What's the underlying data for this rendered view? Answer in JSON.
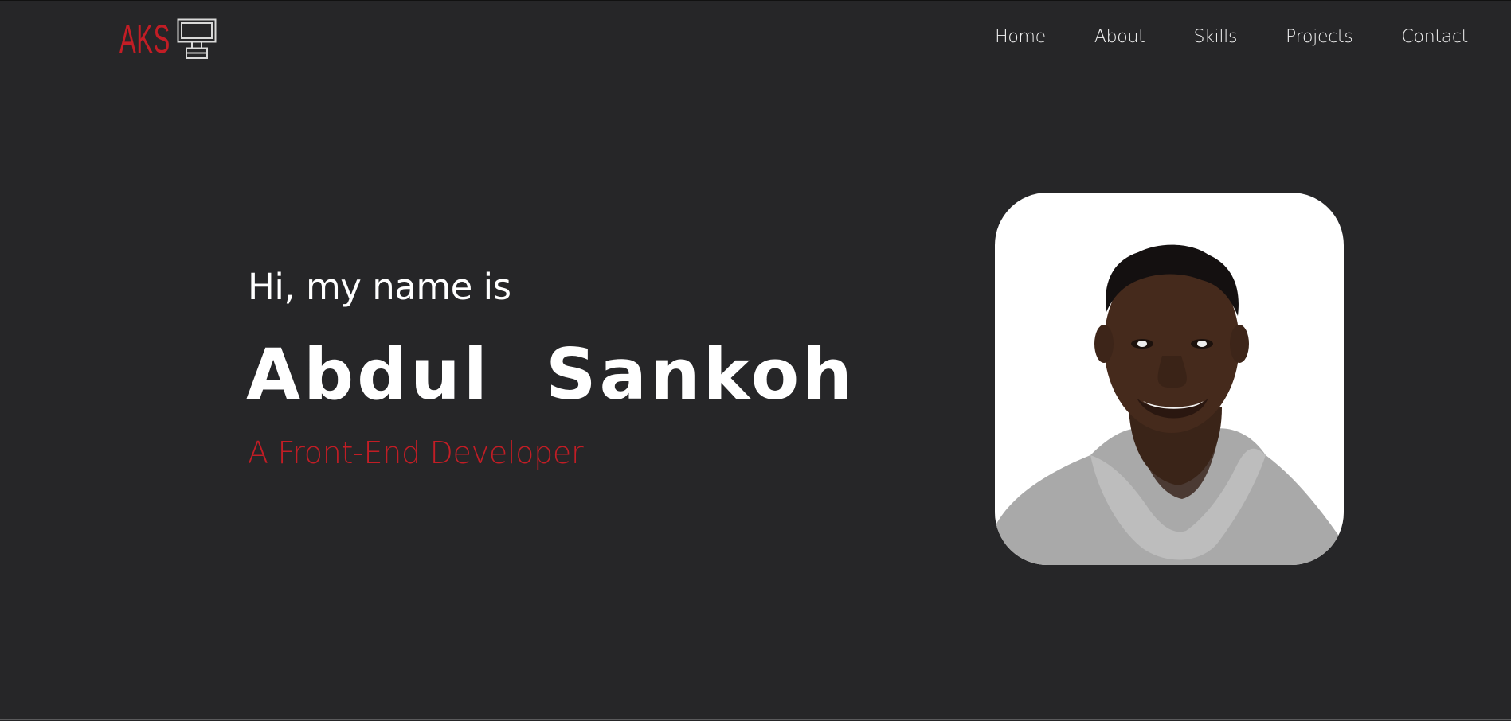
{
  "header": {
    "logo_text": "AKS",
    "logo_icon": "monitor-icon",
    "nav": [
      {
        "label": "Home"
      },
      {
        "label": "About"
      },
      {
        "label": "Skills"
      },
      {
        "label": "Projects"
      },
      {
        "label": "Contact"
      }
    ]
  },
  "hero": {
    "greeting": "Hi, my name is",
    "name": "Abdul  Sankoh",
    "role": "A Front-End Developer",
    "photo": "profile-photo"
  },
  "colors": {
    "background": "#262628",
    "accent": "#c21d25",
    "text": "#ffffff",
    "photo_bg": "#ffffff"
  }
}
